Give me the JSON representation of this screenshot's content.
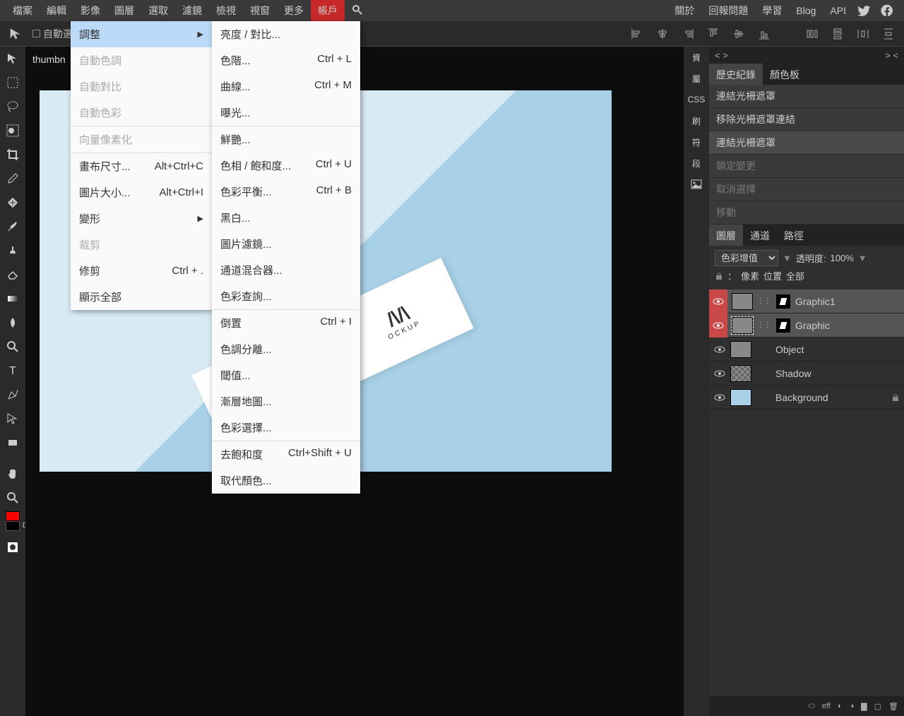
{
  "menubar": {
    "items": [
      "檔案",
      "編輯",
      "影像",
      "圖層",
      "選取",
      "濾鏡",
      "檢視",
      "視窗",
      "更多",
      "帳戶"
    ],
    "right": [
      "關於",
      "回報問題",
      "學習",
      "Blog",
      "API"
    ]
  },
  "options": {
    "auto_select": "自動選"
  },
  "doc_tab": "thumbn",
  "side_tabs": [
    "資",
    "屬",
    "CSS",
    "刷",
    "符",
    "段"
  ],
  "panel_nav": {
    "left": "< >",
    "right": "> <"
  },
  "history": {
    "tabs": [
      "歷史紀錄",
      "顏色板"
    ],
    "items": [
      {
        "label": "連結光柵遮罩",
        "state": "normal"
      },
      {
        "label": "移除光柵遮罩連結",
        "state": "normal"
      },
      {
        "label": "連結光柵遮罩",
        "state": "active"
      },
      {
        "label": "鎖定變更",
        "state": "disabled"
      },
      {
        "label": "取消選擇",
        "state": "disabled"
      },
      {
        "label": "移動",
        "state": "disabled"
      }
    ]
  },
  "layers": {
    "tabs": [
      "圖層",
      "通道",
      "路徑"
    ],
    "blend_mode": "色彩增值",
    "opacity_label": "透明度:",
    "opacity_value": "100%",
    "lock_label": "：",
    "lock_opts": [
      "像素",
      "位置",
      "全部"
    ],
    "items": [
      {
        "name": "Graphic1",
        "selected": true,
        "mask": true
      },
      {
        "name": "Graphic",
        "selected": true,
        "mask": true
      },
      {
        "name": "Object",
        "selected": false,
        "mask": false
      },
      {
        "name": "Shadow",
        "selected": false,
        "mask": false
      },
      {
        "name": "Background",
        "selected": false,
        "mask": false,
        "locked": true
      }
    ]
  },
  "footer": {
    "eff": "eff"
  },
  "dropdown1": [
    {
      "label": "調整",
      "arrow": true,
      "highlight": true
    },
    {
      "label": "自動色調",
      "disabled": true
    },
    {
      "label": "自動對比",
      "disabled": true
    },
    {
      "label": "自動色彩",
      "disabled": true
    },
    {
      "sep": true
    },
    {
      "label": "向量像素化",
      "disabled": true
    },
    {
      "sep": true
    },
    {
      "label": "畫布尺寸...",
      "shortcut": "Alt+Ctrl+C"
    },
    {
      "label": "圖片大小...",
      "shortcut": "Alt+Ctrl+I"
    },
    {
      "label": "變形",
      "arrow": true
    },
    {
      "label": "裁剪",
      "disabled": true
    },
    {
      "label": "修剪",
      "shortcut": "Ctrl + ."
    },
    {
      "label": "顯示全部"
    }
  ],
  "dropdown2": [
    {
      "label": "亮度 / 對比..."
    },
    {
      "label": "色階...",
      "shortcut": "Ctrl + L"
    },
    {
      "label": "曲線...",
      "shortcut": "Ctrl + M"
    },
    {
      "label": "曝光..."
    },
    {
      "sep": true
    },
    {
      "label": "鮮艷..."
    },
    {
      "label": "色相 / 飽和度...",
      "shortcut": "Ctrl + U"
    },
    {
      "label": "色彩平衡...",
      "shortcut": "Ctrl + B"
    },
    {
      "label": "黑白..."
    },
    {
      "label": "圖片濾鏡..."
    },
    {
      "label": "通道混合器..."
    },
    {
      "label": "色彩查詢..."
    },
    {
      "sep": true
    },
    {
      "label": "倒置",
      "shortcut": "Ctrl + I"
    },
    {
      "label": "色調分離..."
    },
    {
      "label": "閾值..."
    },
    {
      "label": "漸層地圖..."
    },
    {
      "label": "色彩選擇..."
    },
    {
      "sep": true
    },
    {
      "label": "去飽和度",
      "shortcut": "Ctrl+Shift + U"
    },
    {
      "label": "取代顏色..."
    }
  ],
  "mockup": {
    "letter": "ᴍ",
    "text": "OCKUP"
  }
}
